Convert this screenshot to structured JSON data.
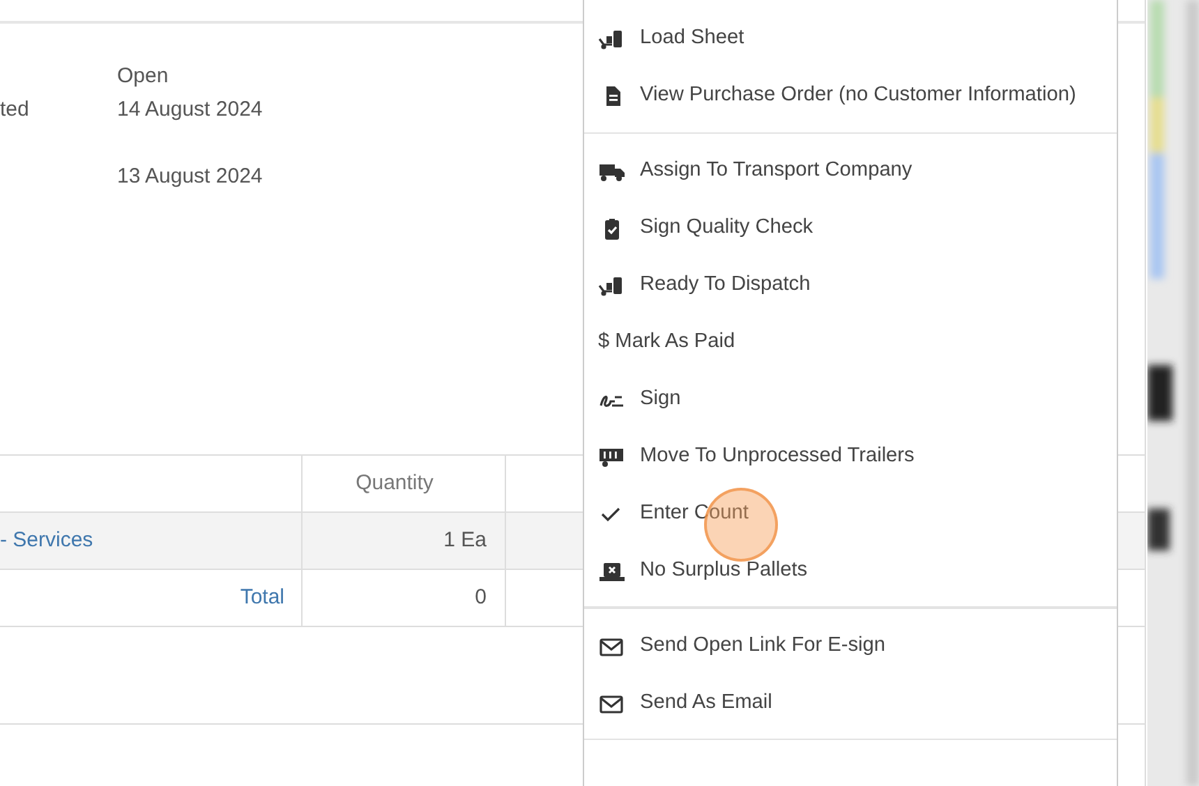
{
  "details": [
    [
      {
        "value": "Open"
      },
      {
        "label": "ted",
        "value": "14 August 2024"
      }
    ],
    [
      {
        "value": "13 August 2024"
      }
    ]
  ],
  "table": {
    "columns": [
      "Quantity"
    ],
    "rows": [
      {
        "cells": [
          "- Services",
          "1 Ea"
        ],
        "kind": "item"
      },
      {
        "cells": [
          "Total",
          "0"
        ],
        "kind": "total"
      }
    ]
  },
  "menu": {
    "groups": [
      [
        {
          "kind": "dolly",
          "label": "Load Sheet"
        },
        {
          "kind": "file",
          "label": "View Purchase Order (no Customer Information)"
        }
      ],
      [
        {
          "kind": "truck",
          "label": "Assign To Transport Company"
        },
        {
          "kind": "clipboard",
          "label": "Sign Quality Check"
        },
        {
          "kind": "dolly",
          "label": "Ready To Dispatch"
        },
        {
          "kind": "text",
          "label": "$ Mark As Paid"
        },
        {
          "kind": "signature",
          "label": "Sign"
        },
        {
          "kind": "trailer",
          "label": "Move To Unprocessed Trailers"
        },
        {
          "kind": "check",
          "label": "Enter Count"
        },
        {
          "kind": "pallet",
          "label": "No Surplus Pallets"
        }
      ],
      [
        {
          "kind": "envelope",
          "label": "Send Open Link For E-sign"
        },
        {
          "kind": "envelope",
          "label": "Send As Email"
        }
      ]
    ]
  },
  "cursor_highlight": true
}
